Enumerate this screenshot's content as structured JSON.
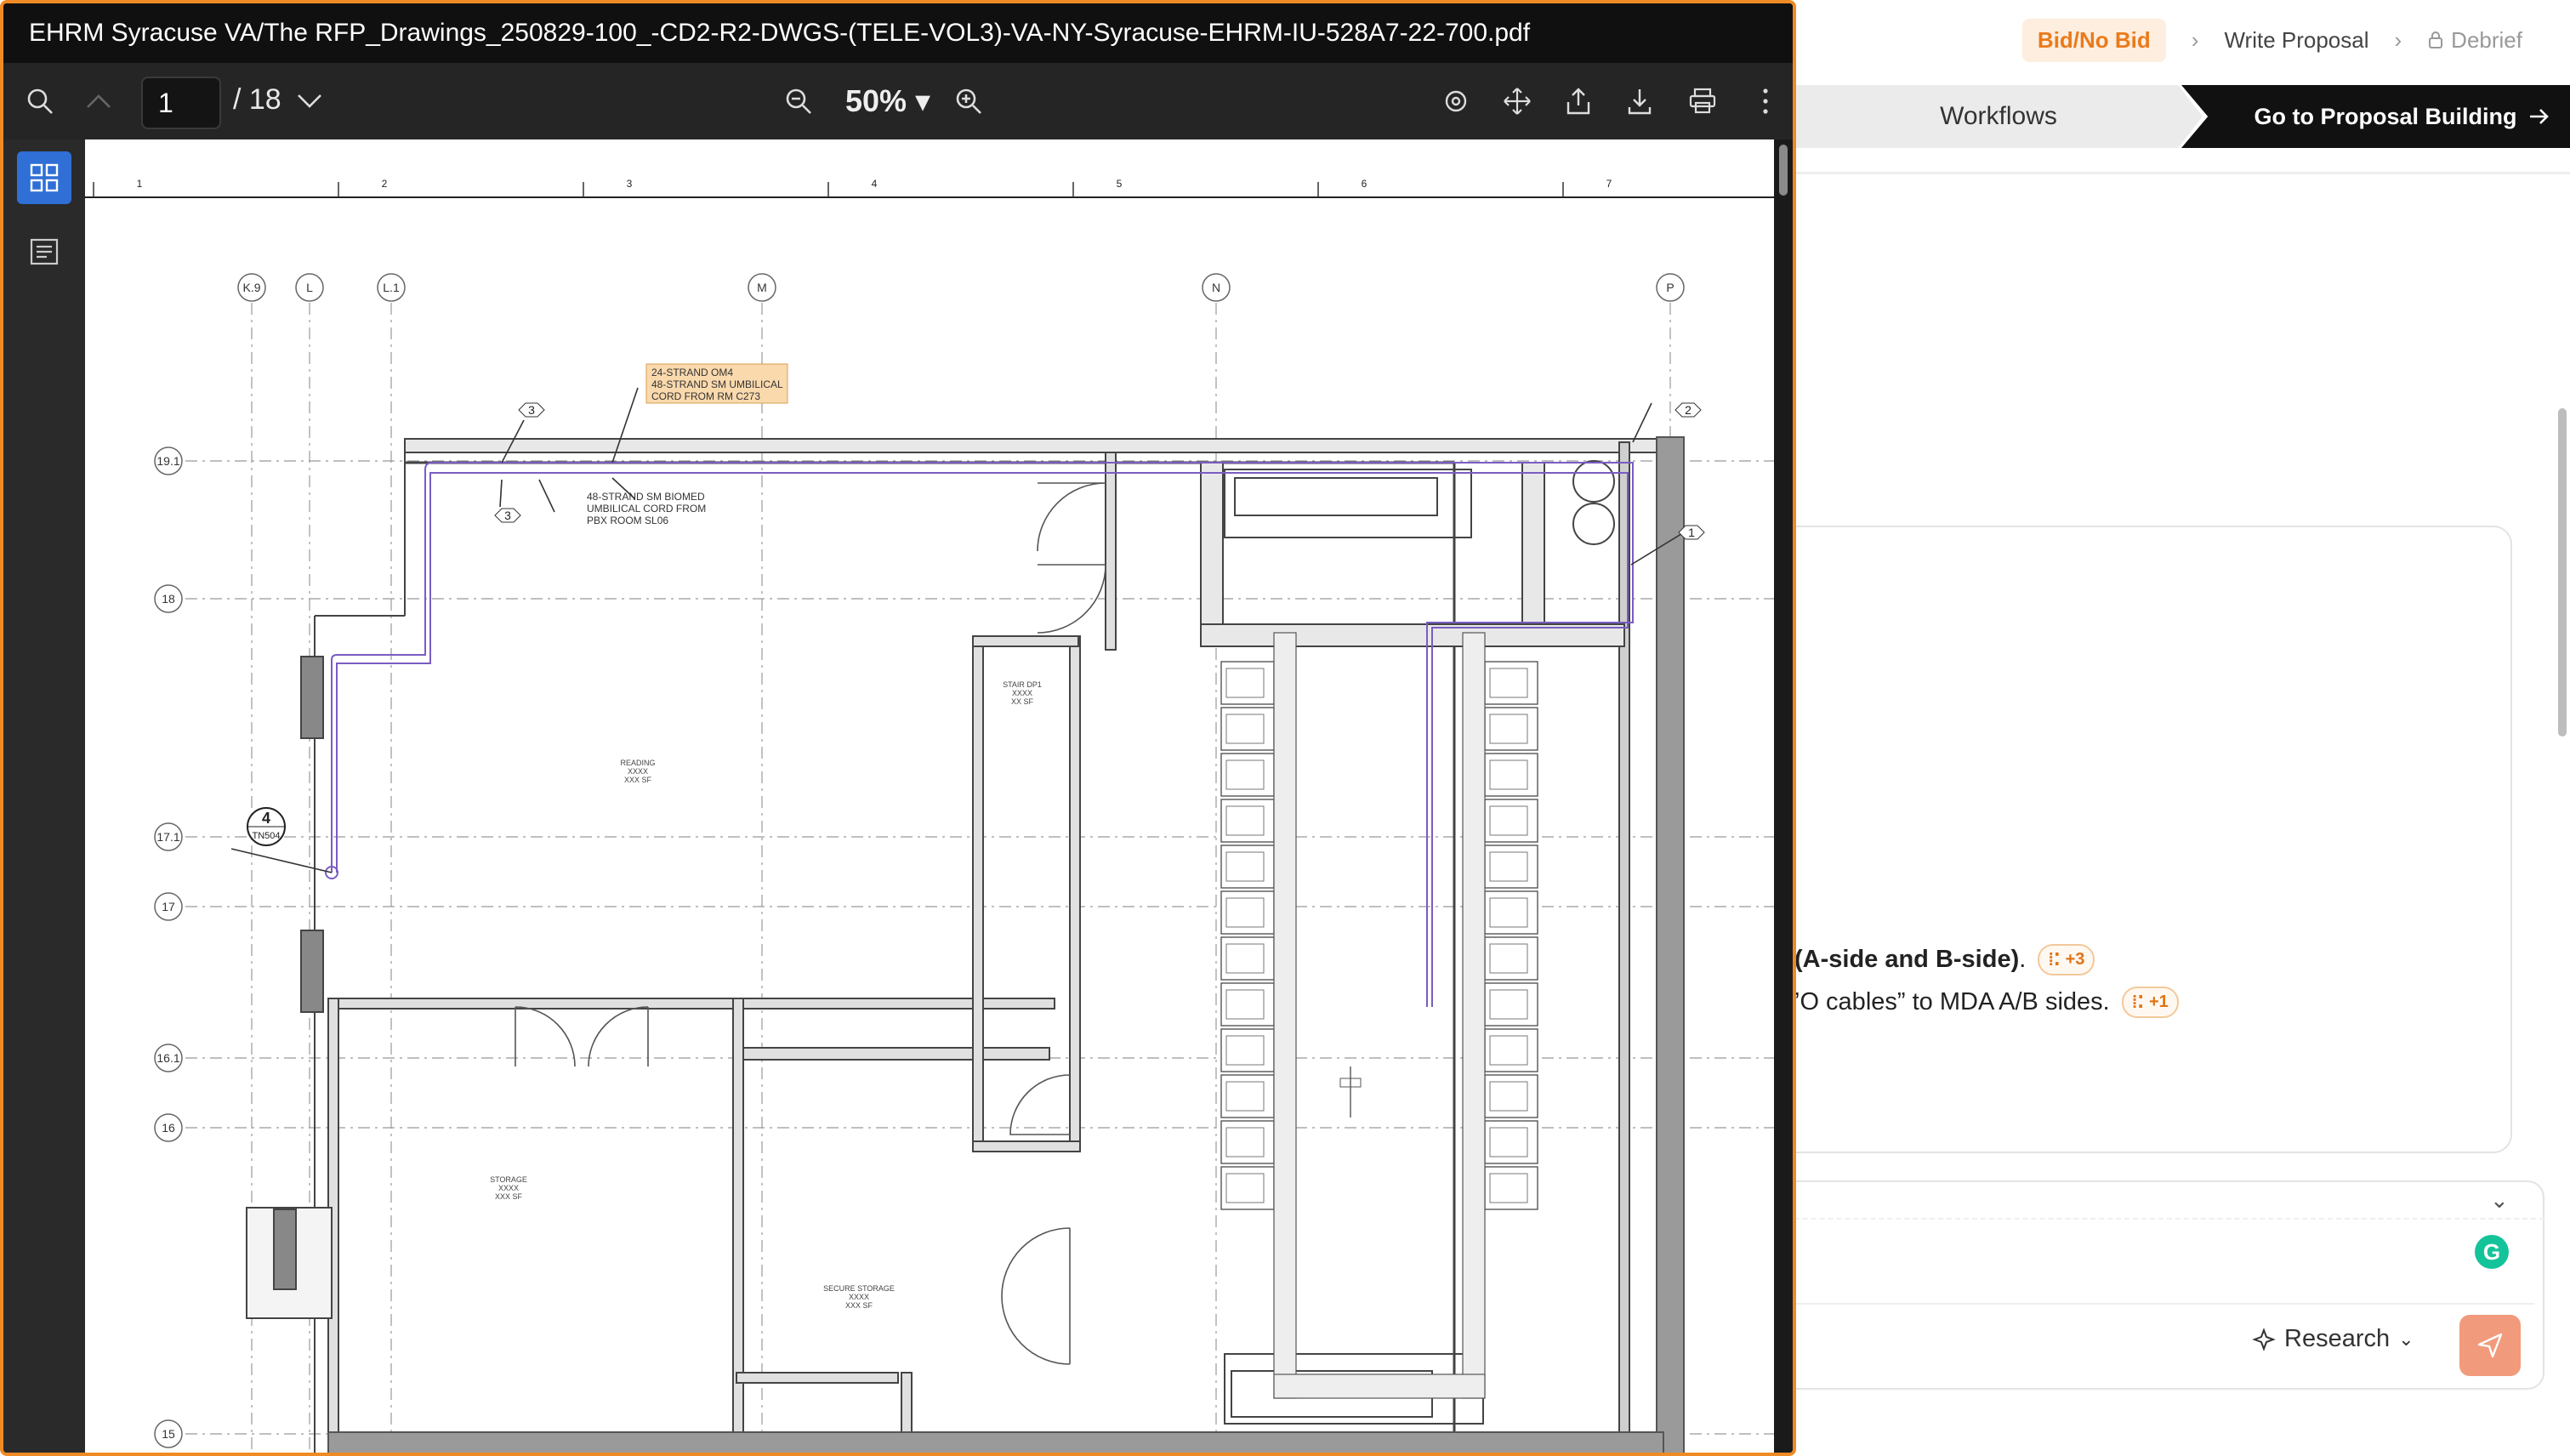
{
  "app": {
    "steps": [
      {
        "label": "Bid/No Bid",
        "state": "active"
      },
      {
        "label": "Write Proposal",
        "state": "normal"
      },
      {
        "label": "Debrief",
        "state": "locked"
      }
    ],
    "tabs": {
      "workflows": "Workflows",
      "go_proposal": "Go to Proposal Building"
    },
    "chat": {
      "line1_bold": "(A-side and B-side)",
      "line1_tail": ".",
      "line1_cite": "+3",
      "line2_text": "’O cables” to MDA A/B sides.",
      "line2_cite": "+1"
    },
    "composer": {
      "research_label": "Research"
    },
    "colors": {
      "accent": "#ea7a1b",
      "send": "#f19b7c",
      "viewer_border": "#f08a24"
    }
  },
  "viewer": {
    "title": "EHRM Syracuse VA/The RFP_Drawings_250829-100_-CD2-R2-DWGS-(TELE-VOL3)-VA-NY-Syracuse-EHRM-IU-528A7-22-700.pdf",
    "page_current": "1",
    "page_total": "/ 18",
    "zoom": "50% ▾",
    "icons": [
      "search-icon",
      "prev-page-icon",
      "next-page-icon",
      "zoom-out-icon",
      "zoom-in-icon",
      "rotate-icon",
      "pan-icon",
      "share-icon",
      "download-icon",
      "print-icon",
      "more-icon",
      "thumbnails-icon",
      "outline-icon"
    ]
  },
  "drawing": {
    "ruler": [
      "1",
      "2",
      "3",
      "4",
      "5",
      "6",
      "7"
    ],
    "col_grid": [
      "K.9",
      "L",
      "L.1",
      "M",
      "N",
      "P"
    ],
    "row_grid": [
      "19.1",
      "18",
      "17.1",
      "17",
      "16.1",
      "16",
      "15"
    ],
    "callout_box": [
      "24-STRAND OM4",
      "48-STRAND SM UMBILICAL",
      "CORD FROM RM C273"
    ],
    "biomed_note": [
      "48-STRAND SM BIOMED",
      "UMBILICAL CORD FROM",
      "PBX ROOM SL06"
    ],
    "tags": {
      "t3a": "3",
      "t3b": "3",
      "t2": "2",
      "t1": "1"
    },
    "detail_tag": {
      "num": "4",
      "sheet": "TN504"
    },
    "rooms": {
      "reading": [
        "READING",
        "XXXX",
        "XXX SF"
      ],
      "stair": [
        "STAIR DP1",
        "XXXX",
        "XX SF"
      ],
      "storage": [
        "STORAGE",
        "XXXX",
        "XXX SF"
      ],
      "secure": [
        "SECURE STORAGE",
        "XXXX",
        "XXX SF"
      ]
    }
  }
}
